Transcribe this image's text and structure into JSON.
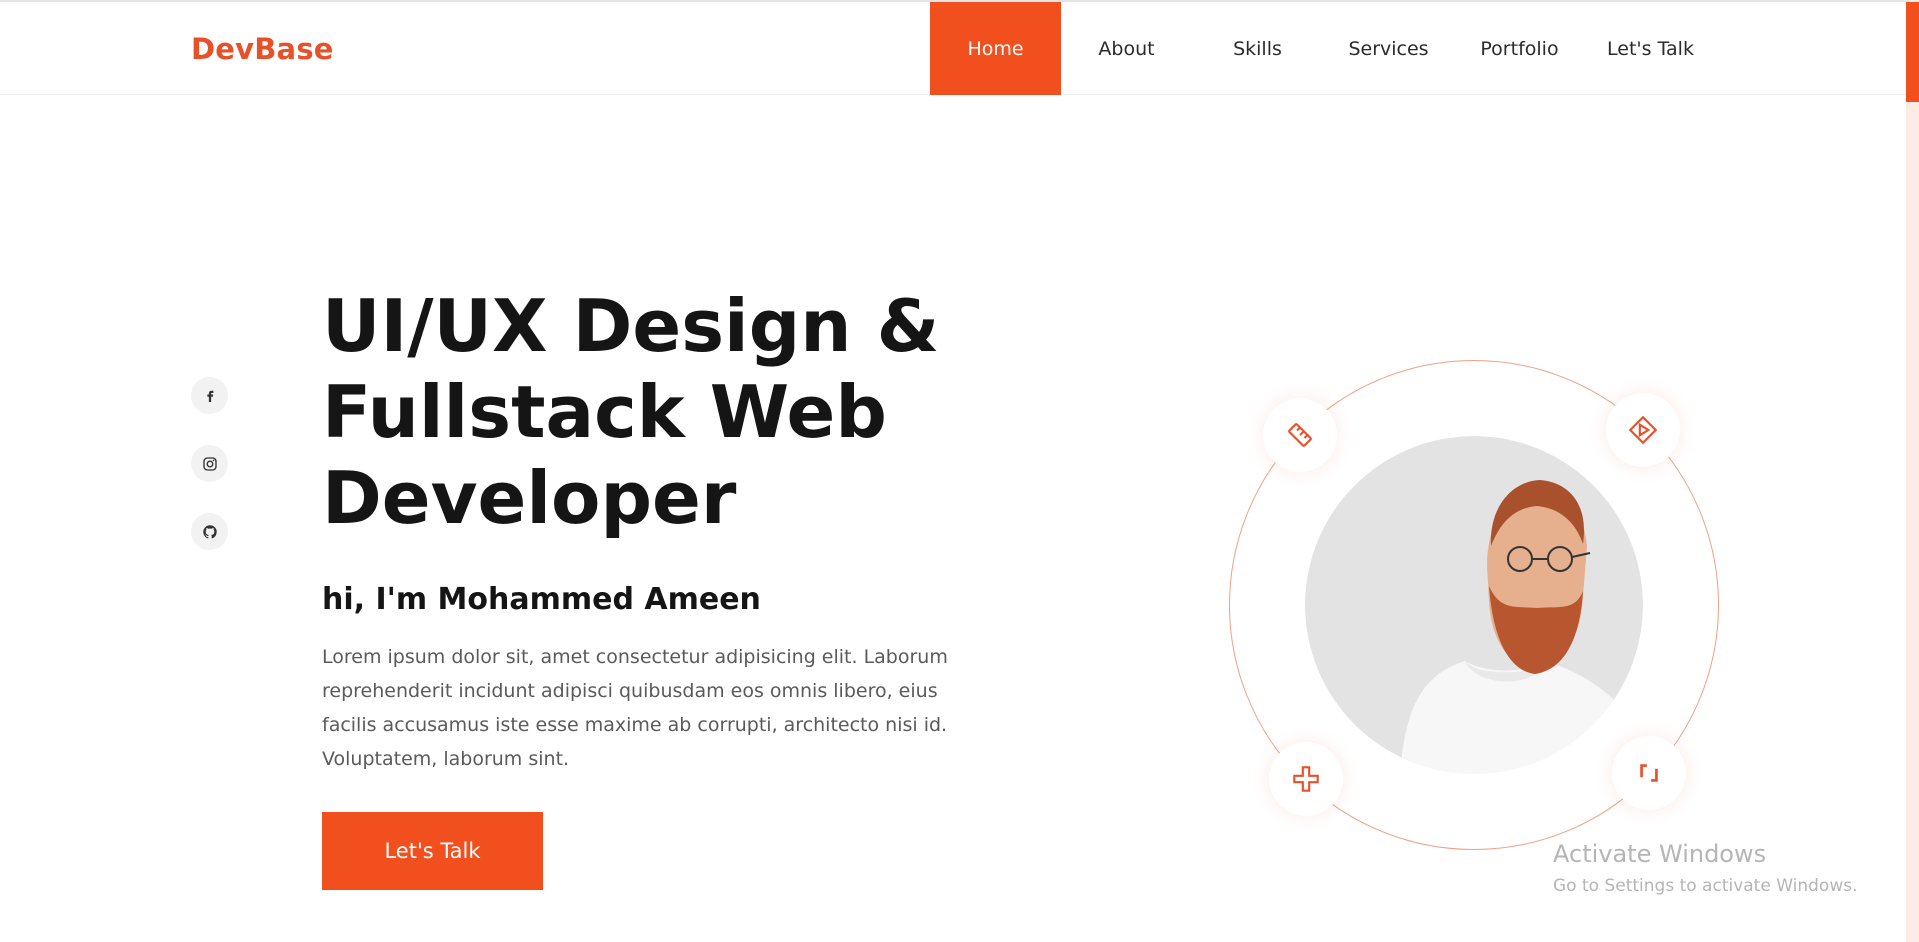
{
  "brand": {
    "logo": "DevBase",
    "accent_color": "#f24f1f"
  },
  "nav": {
    "items": [
      {
        "label": "Home",
        "active": true
      },
      {
        "label": "About",
        "active": false
      },
      {
        "label": "Skills",
        "active": false
      },
      {
        "label": "Services",
        "active": false
      },
      {
        "label": "Portfolio",
        "active": false
      },
      {
        "label": "Let's Talk",
        "active": false
      }
    ]
  },
  "socials": [
    {
      "icon": "facebook-icon"
    },
    {
      "icon": "instagram-icon"
    },
    {
      "icon": "github-icon"
    }
  ],
  "hero": {
    "title_line1": "UI/UX Design &",
    "title_line2": "Fullstack Web",
    "title_line3": "Developer",
    "greeting": "hi, I'm Mohammed Ameen",
    "description": "Lorem ipsum dolor sit, amet consectetur adipisicing elit. Laborum reprehenderit incidunt adipisci quibusdam eos omnis libero, eius facilis accusamus iste esse maxime ab corrupti, architecto nisi id. Voluptatem, laborum sint.",
    "cta_label": "Let's Talk"
  },
  "orbit_badges": [
    {
      "icon": "design-tools-icon"
    },
    {
      "icon": "play-diamond-icon"
    },
    {
      "icon": "cross-shape-icon"
    },
    {
      "icon": "crop-corner-icon"
    }
  ],
  "watermark": {
    "line1": "Activate Windows",
    "line2": "Go to Settings to activate Windows."
  }
}
